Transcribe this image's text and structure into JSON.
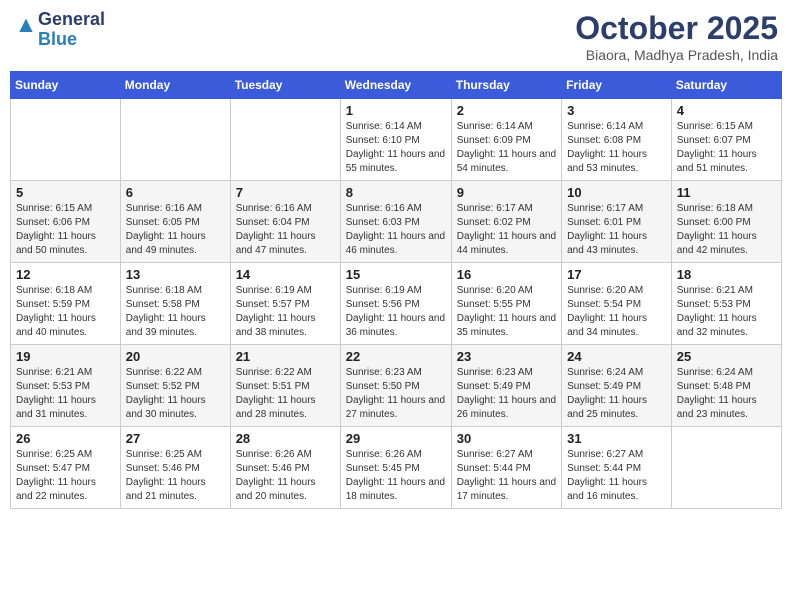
{
  "header": {
    "logo_general": "General",
    "logo_blue": "Blue",
    "month_title": "October 2025",
    "subtitle": "Biaora, Madhya Pradesh, India"
  },
  "days_of_week": [
    "Sunday",
    "Monday",
    "Tuesday",
    "Wednesday",
    "Thursday",
    "Friday",
    "Saturday"
  ],
  "weeks": [
    [
      {
        "day": "",
        "info": ""
      },
      {
        "day": "",
        "info": ""
      },
      {
        "day": "",
        "info": ""
      },
      {
        "day": "1",
        "info": "Sunrise: 6:14 AM\nSunset: 6:10 PM\nDaylight: 11 hours and 55 minutes."
      },
      {
        "day": "2",
        "info": "Sunrise: 6:14 AM\nSunset: 6:09 PM\nDaylight: 11 hours and 54 minutes."
      },
      {
        "day": "3",
        "info": "Sunrise: 6:14 AM\nSunset: 6:08 PM\nDaylight: 11 hours and 53 minutes."
      },
      {
        "day": "4",
        "info": "Sunrise: 6:15 AM\nSunset: 6:07 PM\nDaylight: 11 hours and 51 minutes."
      }
    ],
    [
      {
        "day": "5",
        "info": "Sunrise: 6:15 AM\nSunset: 6:06 PM\nDaylight: 11 hours and 50 minutes."
      },
      {
        "day": "6",
        "info": "Sunrise: 6:16 AM\nSunset: 6:05 PM\nDaylight: 11 hours and 49 minutes."
      },
      {
        "day": "7",
        "info": "Sunrise: 6:16 AM\nSunset: 6:04 PM\nDaylight: 11 hours and 47 minutes."
      },
      {
        "day": "8",
        "info": "Sunrise: 6:16 AM\nSunset: 6:03 PM\nDaylight: 11 hours and 46 minutes."
      },
      {
        "day": "9",
        "info": "Sunrise: 6:17 AM\nSunset: 6:02 PM\nDaylight: 11 hours and 44 minutes."
      },
      {
        "day": "10",
        "info": "Sunrise: 6:17 AM\nSunset: 6:01 PM\nDaylight: 11 hours and 43 minutes."
      },
      {
        "day": "11",
        "info": "Sunrise: 6:18 AM\nSunset: 6:00 PM\nDaylight: 11 hours and 42 minutes."
      }
    ],
    [
      {
        "day": "12",
        "info": "Sunrise: 6:18 AM\nSunset: 5:59 PM\nDaylight: 11 hours and 40 minutes."
      },
      {
        "day": "13",
        "info": "Sunrise: 6:18 AM\nSunset: 5:58 PM\nDaylight: 11 hours and 39 minutes."
      },
      {
        "day": "14",
        "info": "Sunrise: 6:19 AM\nSunset: 5:57 PM\nDaylight: 11 hours and 38 minutes."
      },
      {
        "day": "15",
        "info": "Sunrise: 6:19 AM\nSunset: 5:56 PM\nDaylight: 11 hours and 36 minutes."
      },
      {
        "day": "16",
        "info": "Sunrise: 6:20 AM\nSunset: 5:55 PM\nDaylight: 11 hours and 35 minutes."
      },
      {
        "day": "17",
        "info": "Sunrise: 6:20 AM\nSunset: 5:54 PM\nDaylight: 11 hours and 34 minutes."
      },
      {
        "day": "18",
        "info": "Sunrise: 6:21 AM\nSunset: 5:53 PM\nDaylight: 11 hours and 32 minutes."
      }
    ],
    [
      {
        "day": "19",
        "info": "Sunrise: 6:21 AM\nSunset: 5:53 PM\nDaylight: 11 hours and 31 minutes."
      },
      {
        "day": "20",
        "info": "Sunrise: 6:22 AM\nSunset: 5:52 PM\nDaylight: 11 hours and 30 minutes."
      },
      {
        "day": "21",
        "info": "Sunrise: 6:22 AM\nSunset: 5:51 PM\nDaylight: 11 hours and 28 minutes."
      },
      {
        "day": "22",
        "info": "Sunrise: 6:23 AM\nSunset: 5:50 PM\nDaylight: 11 hours and 27 minutes."
      },
      {
        "day": "23",
        "info": "Sunrise: 6:23 AM\nSunset: 5:49 PM\nDaylight: 11 hours and 26 minutes."
      },
      {
        "day": "24",
        "info": "Sunrise: 6:24 AM\nSunset: 5:49 PM\nDaylight: 11 hours and 25 minutes."
      },
      {
        "day": "25",
        "info": "Sunrise: 6:24 AM\nSunset: 5:48 PM\nDaylight: 11 hours and 23 minutes."
      }
    ],
    [
      {
        "day": "26",
        "info": "Sunrise: 6:25 AM\nSunset: 5:47 PM\nDaylight: 11 hours and 22 minutes."
      },
      {
        "day": "27",
        "info": "Sunrise: 6:25 AM\nSunset: 5:46 PM\nDaylight: 11 hours and 21 minutes."
      },
      {
        "day": "28",
        "info": "Sunrise: 6:26 AM\nSunset: 5:46 PM\nDaylight: 11 hours and 20 minutes."
      },
      {
        "day": "29",
        "info": "Sunrise: 6:26 AM\nSunset: 5:45 PM\nDaylight: 11 hours and 18 minutes."
      },
      {
        "day": "30",
        "info": "Sunrise: 6:27 AM\nSunset: 5:44 PM\nDaylight: 11 hours and 17 minutes."
      },
      {
        "day": "31",
        "info": "Sunrise: 6:27 AM\nSunset: 5:44 PM\nDaylight: 11 hours and 16 minutes."
      },
      {
        "day": "",
        "info": ""
      }
    ]
  ]
}
